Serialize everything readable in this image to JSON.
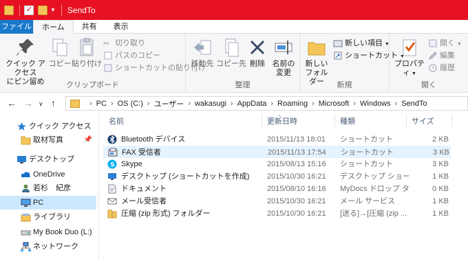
{
  "window": {
    "title": "SendTo"
  },
  "tabs": [
    {
      "label": "ファイル"
    },
    {
      "label": "ホーム"
    },
    {
      "label": "共有"
    },
    {
      "label": "表示"
    }
  ],
  "ribbon": {
    "clipboard": {
      "group_label": "クリップボード",
      "pin_label_1": "クイック アクセス",
      "pin_label_2": "にピン留め",
      "copy_label": "コピー",
      "paste_label": "貼り付け",
      "cut_label": "切り取り",
      "copy_path_label": "パスのコピー",
      "paste_shortcut_label": "ショートカットの貼り付け"
    },
    "organize": {
      "group_label": "整理",
      "move_label": "移動先",
      "copyto_label": "コピー先",
      "delete_label": "削除",
      "rename_label_1": "名前の",
      "rename_label_2": "変更"
    },
    "new": {
      "group_label": "新規",
      "newfolder_label_1": "新しい",
      "newfolder_label_2": "フォルダー",
      "newitem_label": "新しい項目",
      "shortcut_label": "ショートカット"
    },
    "open": {
      "group_label": "開く",
      "properties_label": "プロパティ",
      "open_label": "開く",
      "edit_label": "編集",
      "history_label": "履歴"
    }
  },
  "address": {
    "crumbs": [
      "PC",
      "OS (C:)",
      "ユーザー",
      "wakasugi",
      "AppData",
      "Roaming",
      "Microsoft",
      "Windows",
      "SendTo"
    ]
  },
  "nav": {
    "items": [
      {
        "label": "クイック アクセス",
        "icon": "star-icon"
      },
      {
        "label": "取材写真",
        "icon": "folder-icon"
      },
      {
        "label": "デスクトップ",
        "icon": "desktop-icon"
      },
      {
        "label": "OneDrive",
        "icon": "cloud-icon"
      },
      {
        "label": "若杉　紀彦",
        "icon": "user-icon"
      },
      {
        "label": "PC",
        "icon": "pc-icon"
      },
      {
        "label": "ライブラリ",
        "icon": "library-icon"
      },
      {
        "label": "My Book Duo (L:)",
        "icon": "drive-icon"
      },
      {
        "label": "ネットワーク",
        "icon": "network-icon"
      }
    ]
  },
  "columns": {
    "name": "名前",
    "date": "更新日時",
    "type": "種類",
    "size": "サイズ"
  },
  "files": [
    {
      "name": "Bluetooth デバイス",
      "date": "2015/11/13 18:01",
      "type": "ショートカット",
      "size": "2 KB",
      "icon": "bluetooth-icon"
    },
    {
      "name": "FAX 受信者",
      "date": "2015/11/13 17:54",
      "type": "ショートカット",
      "size": "3 KB",
      "icon": "fax-icon"
    },
    {
      "name": "Skype",
      "date": "2015/08/13 15:16",
      "type": "ショートカット",
      "size": "3 KB",
      "icon": "skype-icon"
    },
    {
      "name": "デスクトップ (ショートカットを作成)",
      "date": "2015/10/30 16:21",
      "type": "デスクトップ ショートカ...",
      "size": "1 KB",
      "icon": "desktop-icon"
    },
    {
      "name": "ドキュメント",
      "date": "2015/08/10 16:16",
      "type": "MyDocs ドロップ タ...",
      "size": "0 KB",
      "icon": "document-icon"
    },
    {
      "name": "メール受信者",
      "date": "2015/10/30 16:21",
      "type": "メール サービス",
      "size": "1 KB",
      "icon": "mail-icon"
    },
    {
      "name": "圧縮 (zip 形式) フォルダー",
      "date": "2015/10/30 16:21",
      "type": "[送る]→[圧縮 (zip ...",
      "size": "1 KB",
      "icon": "zip-folder-icon"
    }
  ]
}
